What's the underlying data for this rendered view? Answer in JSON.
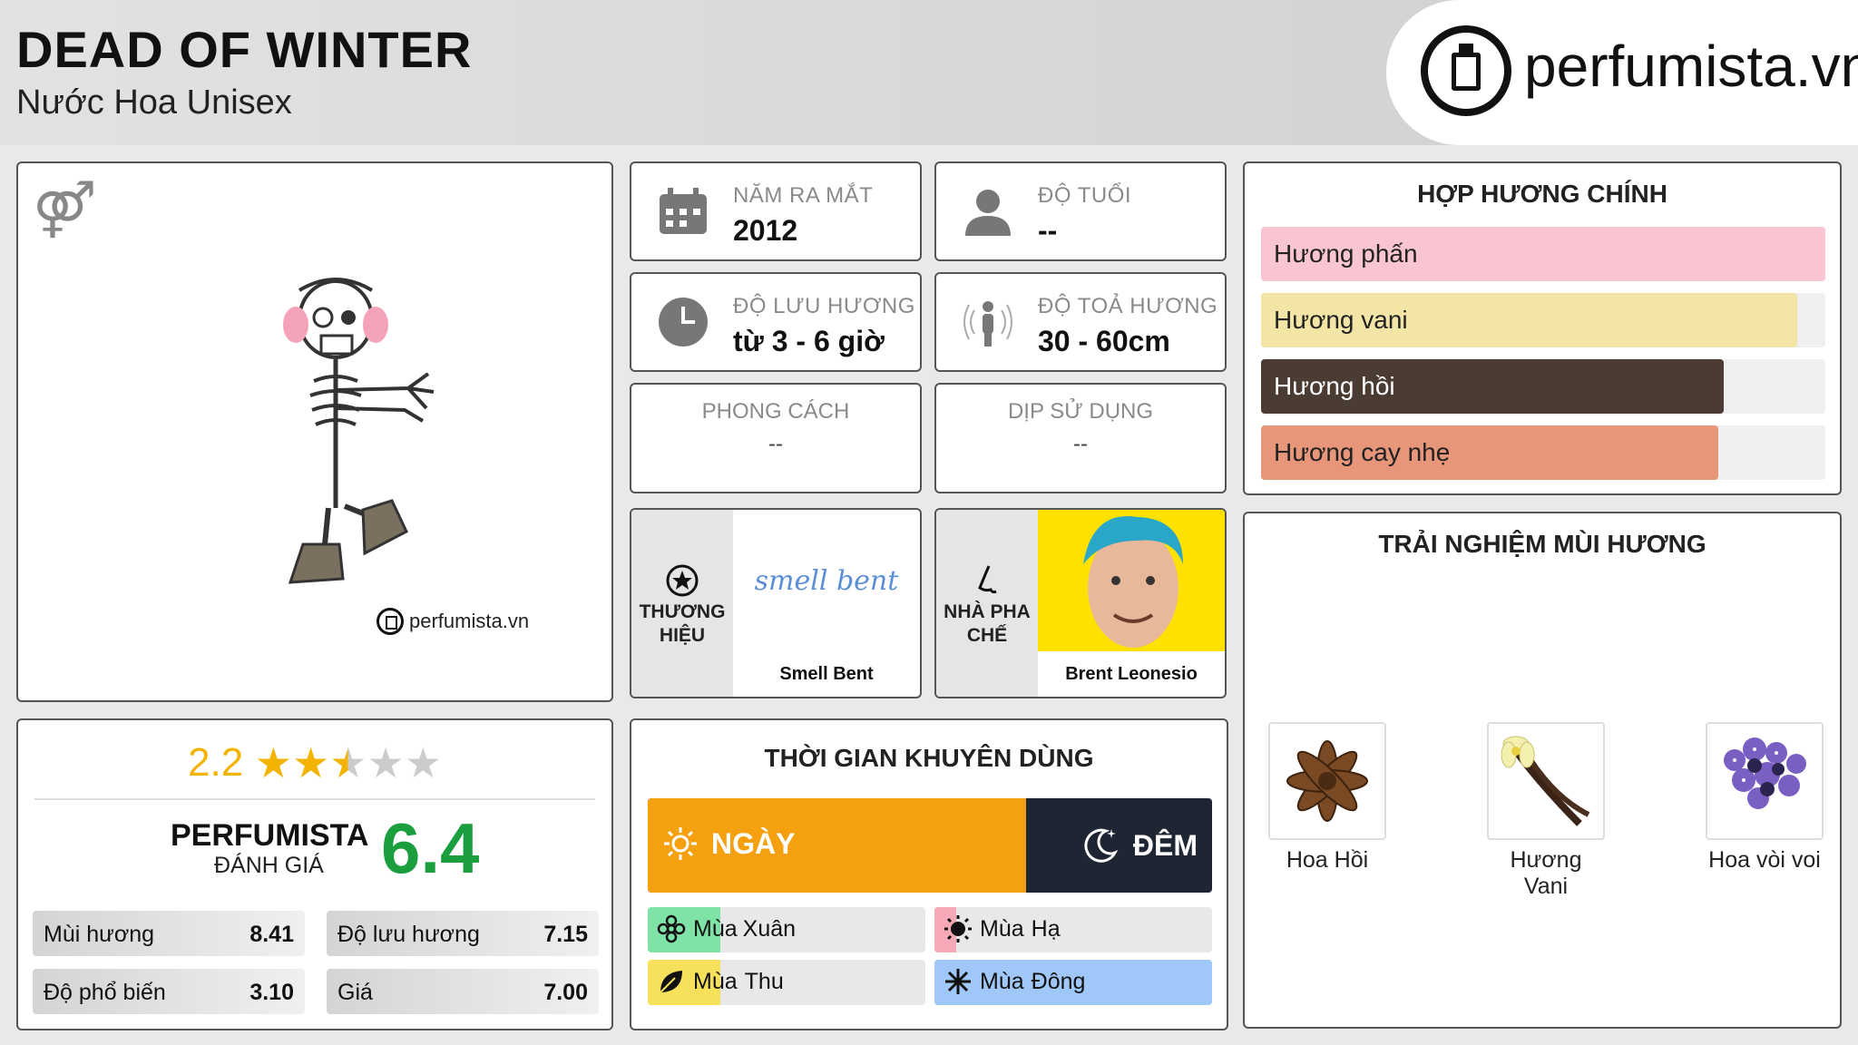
{
  "header": {
    "title": "DEAD OF WINTER",
    "subtitle": "Nước Hoa Unisex",
    "logo_text": "perfumista.vn"
  },
  "image_panel": {
    "gender_icon": "unisex-icon",
    "brand_watermark": "perfumista.vn"
  },
  "info": {
    "release": {
      "label": "NĂM RA MẮT",
      "value": "2012",
      "icon": "calendar-icon"
    },
    "age": {
      "label": "ĐỘ TUỔI",
      "value": "--",
      "icon": "person-icon"
    },
    "longevity": {
      "label": "ĐỘ LƯU HƯƠNG",
      "value": "từ 3 - 6 giờ",
      "icon": "clock-icon"
    },
    "sillage": {
      "label": "ĐỘ TOẢ HƯƠNG",
      "value": "30 - 60cm",
      "icon": "sillage-icon"
    },
    "style": {
      "label": "PHONG CÁCH",
      "value": "--"
    },
    "occasion": {
      "label": "DỊP SỬ DỤNG",
      "value": "--"
    },
    "brand": {
      "label": "THƯƠNG HIỆU",
      "name": "Smell Bent",
      "logo_text": "smell bent",
      "icon": "star-badge-icon"
    },
    "perfumer": {
      "label": "NHÀ PHA CHẾ",
      "name": "Brent Leonesio",
      "icon": "nose-icon"
    }
  },
  "accords": {
    "title": "HỢP HƯƠNG CHÍNH",
    "items": [
      {
        "label": "Hương phấn",
        "percent": 100,
        "color": "#f9c5d1",
        "text_color": "#222222"
      },
      {
        "label": "Hương vani",
        "percent": 95,
        "color": "#f2e5a6",
        "text_color": "#222222"
      },
      {
        "label": "Hương hồi",
        "percent": 82,
        "color": "#4a3c33",
        "text_color": "#ffffff"
      },
      {
        "label": "Hương cay nhẹ",
        "percent": 81,
        "color": "#e8967a",
        "text_color": "#222222"
      }
    ]
  },
  "notes": {
    "title": "TRẢI NGHIỆM MÙI HƯƠNG",
    "items": [
      {
        "label": "Hoa Hồi"
      },
      {
        "label": "Hương Vani"
      },
      {
        "label": "Hoa vòi voi"
      }
    ]
  },
  "rating": {
    "score": "2.2",
    "stars": 2.2,
    "perfumista_label": "PERFUMISTA",
    "perfumista_sub": "ĐÁNH GIÁ",
    "perfumista_score": "6.4",
    "scores": [
      {
        "label": "Mùi hương",
        "value": "8.41"
      },
      {
        "label": "Độ lưu hương",
        "value": "7.15"
      },
      {
        "label": "Độ phổ biến",
        "value": "3.10"
      },
      {
        "label": "Giá",
        "value": "7.00"
      }
    ]
  },
  "time": {
    "title": "THỜI GIAN KHUYÊN DÙNG",
    "day_label": "NGÀY",
    "night_label": "ĐÊM",
    "day_percent": 67,
    "colors": {
      "day": "#f5a10f",
      "night": "#1e2533"
    },
    "seasons": [
      {
        "prefix": "Mùa",
        "name": "Xuân",
        "fill_percent": 26,
        "color": "#7fe3a7",
        "icon": "spring-flower-icon"
      },
      {
        "prefix": "Mùa",
        "name": "Hạ",
        "fill_percent": 8,
        "color": "#f7a9b8",
        "icon": "sun-icon"
      },
      {
        "prefix": "Mùa",
        "name": "Thu",
        "fill_percent": 26,
        "color": "#f8e15a",
        "icon": "leaf-icon"
      },
      {
        "prefix": "Mùa",
        "name": "Đông",
        "fill_percent": 100,
        "color": "#9fc7f7",
        "icon": "snowflake-icon"
      }
    ]
  }
}
